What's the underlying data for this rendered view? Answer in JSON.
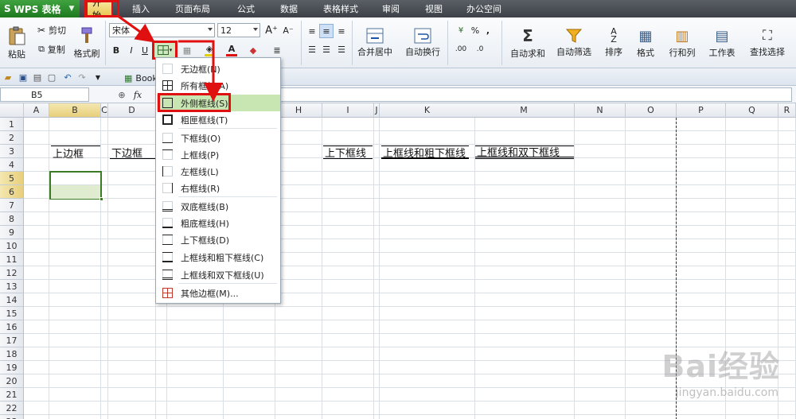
{
  "app": {
    "name": "WPS 表格",
    "logo": "S"
  },
  "menu": {
    "tabs": [
      {
        "label": "开始",
        "active": true
      },
      {
        "label": "插入"
      },
      {
        "label": "页面布局"
      },
      {
        "label": "公式"
      },
      {
        "label": "数据"
      },
      {
        "label": "表格样式"
      },
      {
        "label": "审阅"
      },
      {
        "label": "视图"
      },
      {
        "label": "办公空间"
      }
    ]
  },
  "ribbon": {
    "paste": "粘贴",
    "cut": "剪切",
    "copy": "复制",
    "format_painter": "格式刷",
    "font_name": "宋体",
    "font_size": "12",
    "bold": "B",
    "italic": "I",
    "underline": "U",
    "merge_center": "合并居中",
    "wrap_text": "自动换行",
    "percent": "%",
    "comma": ",",
    "autosum": "自动求和",
    "autofilter": "自动筛选",
    "sort": "排序",
    "format": "格式",
    "rows_cols": "行和列",
    "worksheet": "工作表",
    "find_select": "查找选择"
  },
  "quickbar": {
    "book_tab": "Book3 *"
  },
  "formula_bar": {
    "name_box": "B5",
    "fx": "fx"
  },
  "grid": {
    "columns": [
      "A",
      "B",
      "C",
      "D",
      "E",
      "F",
      "G",
      "H",
      "I",
      "J",
      "K",
      "L",
      "M",
      "N",
      "O",
      "P",
      "Q",
      "R"
    ],
    "selected_column": "B",
    "rows": [
      "1",
      "2",
      "3",
      "4",
      "5",
      "6",
      "7",
      "8",
      "9",
      "10",
      "11",
      "12",
      "13",
      "14",
      "15",
      "16",
      "17",
      "18",
      "19",
      "20",
      "21",
      "22",
      "23"
    ],
    "selected_rows": [
      "5",
      "6"
    ],
    "cells": {
      "B3": "上边框",
      "D3": "下边框",
      "J3": "上下框线",
      "L3": "上框线和粗下框线",
      "N3": "上框线和双下框线"
    }
  },
  "border_menu": {
    "items": [
      {
        "label": "无边框(N)"
      },
      {
        "label": "所有框线(A)"
      },
      {
        "label": "外侧框线(S)",
        "highlighted": true
      },
      {
        "label": "粗匣框线(T)"
      },
      {
        "label": "下框线(O)"
      },
      {
        "label": "上框线(P)"
      },
      {
        "label": "左框线(L)"
      },
      {
        "label": "右框线(R)"
      },
      {
        "label": "双底框线(B)"
      },
      {
        "label": "粗底框线(H)"
      },
      {
        "label": "上下框线(D)"
      },
      {
        "label": "上框线和粗下框线(C)"
      },
      {
        "label": "上框线和双下框线(U)"
      },
      {
        "label": "其他边框(M)..."
      }
    ]
  },
  "watermark": {
    "brand": "Bai经验",
    "url": "jingyan.baidu.com"
  },
  "colors": {
    "highlight_red": "#e01010",
    "selection_green": "#3d7a28",
    "menu_highlight": "#c8e6b2"
  }
}
